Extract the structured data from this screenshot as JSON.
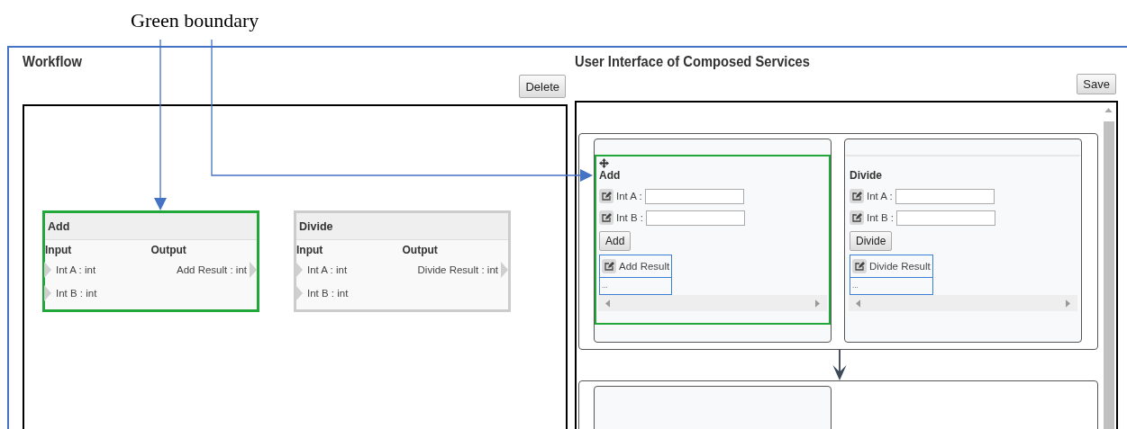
{
  "annotation": {
    "text": "Green boundary"
  },
  "workflow": {
    "title": "Workflow",
    "delete_button": "Delete",
    "nodes": [
      {
        "name": "Add",
        "selected": true,
        "input_heading": "Input",
        "output_heading": "Output",
        "inputs": [
          "Int A : int",
          "Int B : int"
        ],
        "outputs": [
          "Add Result : int"
        ]
      },
      {
        "name": "Divide",
        "selected": false,
        "input_heading": "Input",
        "output_heading": "Output",
        "inputs": [
          "Int A : int",
          "Int B : int"
        ],
        "outputs": [
          "Divide Result : int"
        ]
      }
    ]
  },
  "composer": {
    "title": "User Interface of Composed Services",
    "save_button": "Save",
    "rows": [
      {
        "cards": [
          {
            "kind": "service",
            "title": "Add",
            "selected": true,
            "fields": [
              {
                "label": "Int A :"
              },
              {
                "label": "Int B :"
              }
            ],
            "action_button": "Add",
            "result": {
              "label": "Add Result",
              "value": "..."
            }
          },
          {
            "kind": "service",
            "title": "Divide",
            "selected": false,
            "fields": [
              {
                "label": "Int A :"
              },
              {
                "label": "Int B :"
              }
            ],
            "action_button": "Divide",
            "result": {
              "label": "Divide Result",
              "value": "..."
            }
          }
        ]
      },
      {
        "cards": [
          {
            "kind": "empty"
          }
        ]
      }
    ]
  }
}
